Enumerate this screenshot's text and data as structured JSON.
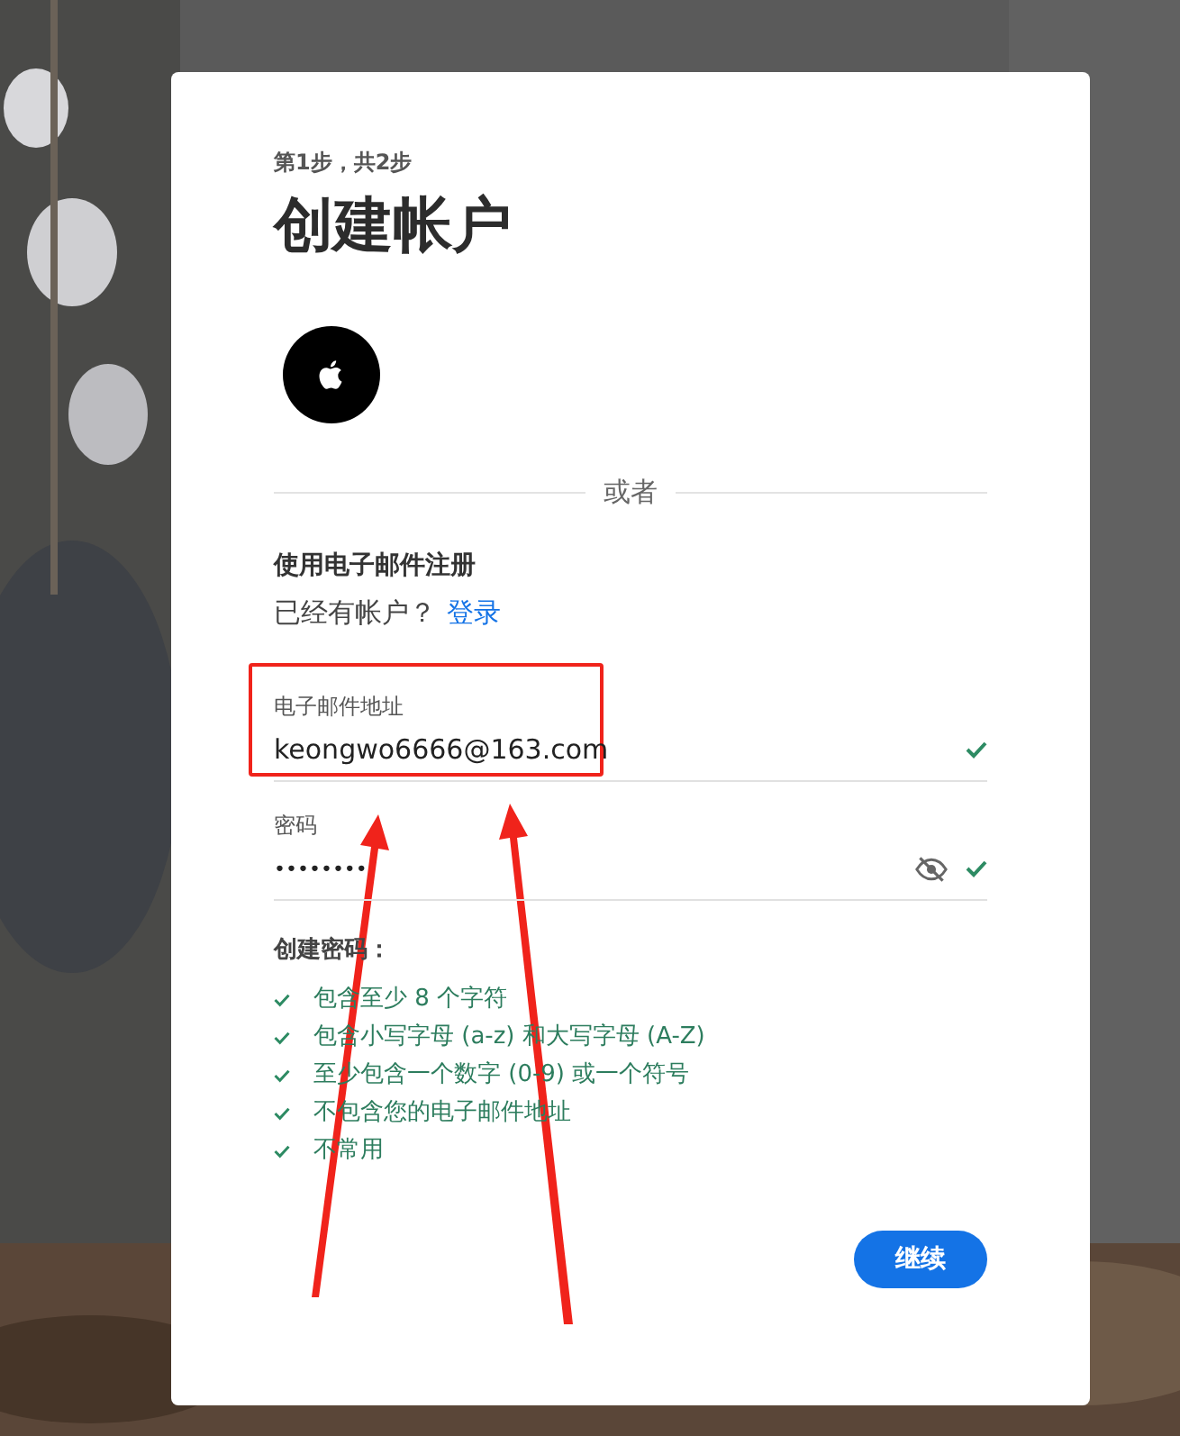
{
  "step": "第1步，共2步",
  "title": "创建帐户",
  "divider_label": "或者",
  "section_title": "使用电子邮件注册",
  "signin_prompt": {
    "text": "已经有帐户？",
    "link": "登录"
  },
  "fields": [
    {
      "kind": "text",
      "label": "电子邮件地址",
      "value": "keongwo6666@163.com",
      "valid": true
    },
    {
      "kind": "password",
      "label": "密码",
      "value": "••••••••",
      "valid": true,
      "masked": true
    }
  ],
  "rules_title": "创建密码：",
  "rules": [
    {
      "text": "包含至少 8 个字符",
      "met": true
    },
    {
      "text": "包含小写字母 (a-z) 和大写字母 (A-Z)",
      "met": true
    },
    {
      "text": "至少包含一个数字 (0-9) 或一个符号",
      "met": true
    },
    {
      "text": "不包含您的电子邮件地址",
      "met": true
    },
    {
      "text": "不常用",
      "met": true
    }
  ],
  "continue_button": "继续"
}
